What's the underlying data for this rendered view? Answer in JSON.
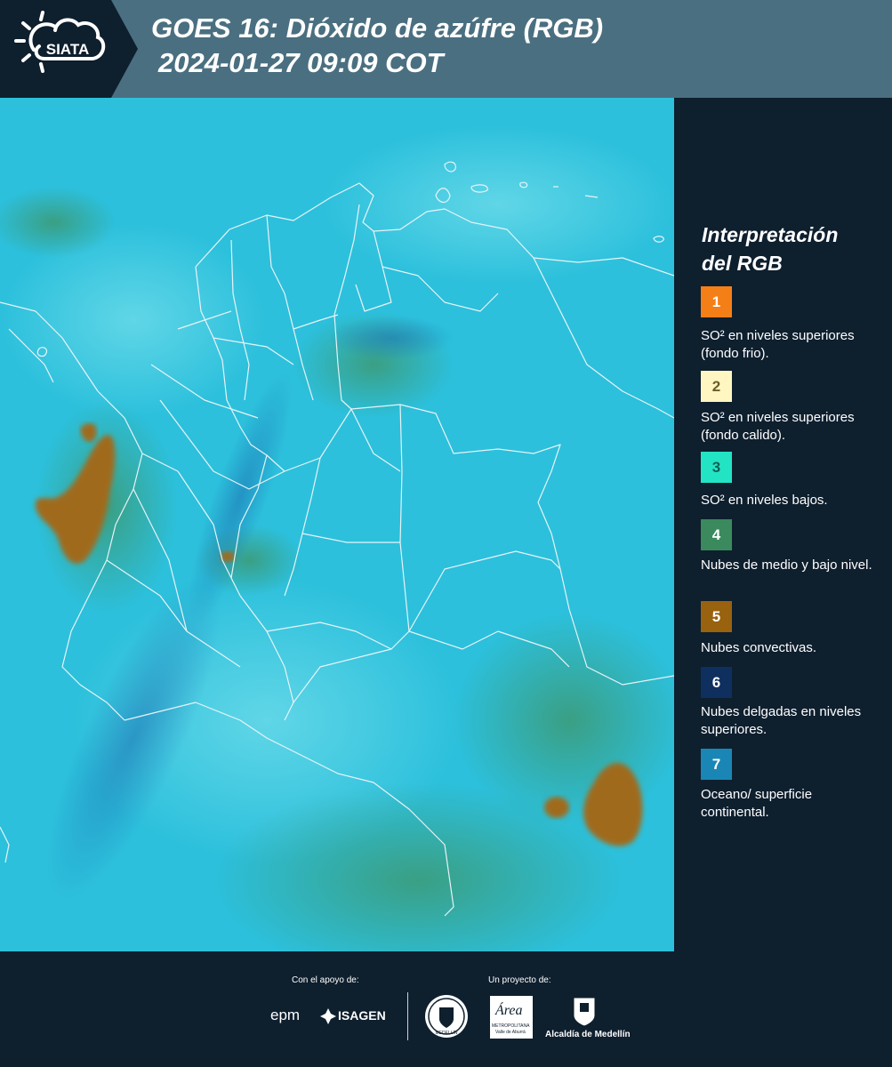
{
  "header": {
    "logo_text": "SIATA",
    "title_line1": "GOES 16: Dióxido de azúfre (RGB)",
    "title_line2": "2024-01-27 09:09 COT"
  },
  "legend": {
    "title_line1": "Interpretación",
    "title_line2": "del RGB",
    "items": [
      {
        "number": "1",
        "color": "#f57f17",
        "number_color": "#ffffff",
        "label": "SO² en niveles superiores (fondo frio)."
      },
      {
        "number": "2",
        "color": "#fff6c2",
        "number_color": "#6b5d2a",
        "label": "SO² en niveles superiores (fondo calido)."
      },
      {
        "number": "3",
        "color": "#22e4c4",
        "number_color": "#145f54",
        "label": "SO² en niveles bajos."
      },
      {
        "number": "4",
        "color": "#3a8a5e",
        "number_color": "#ffffff",
        "label": "Nubes de medio y bajo nivel."
      },
      {
        "number": "5",
        "color": "#99620f",
        "number_color": "#ffffff",
        "label": "Nubes convectivas."
      },
      {
        "number": "6",
        "color": "#0f2f5f",
        "number_color": "#ffffff",
        "label": "Nubes delgadas en niveles superiores."
      },
      {
        "number": "7",
        "color": "#1a86b5",
        "number_color": "#ffffff",
        "label": "Oceano/ superficie continental."
      }
    ]
  },
  "footer": {
    "support_label": "Con el apoyo de:",
    "project_label": "Un proyecto de:",
    "epm": "epm",
    "isagen": "ISAGEN",
    "area_word": "Área",
    "area_sub1": "METROPOLITANA",
    "area_sub2": "Valle de Aburrá",
    "alcaldia": "Alcaldía de Medellín",
    "seal_text": "MEDELLÍN"
  }
}
